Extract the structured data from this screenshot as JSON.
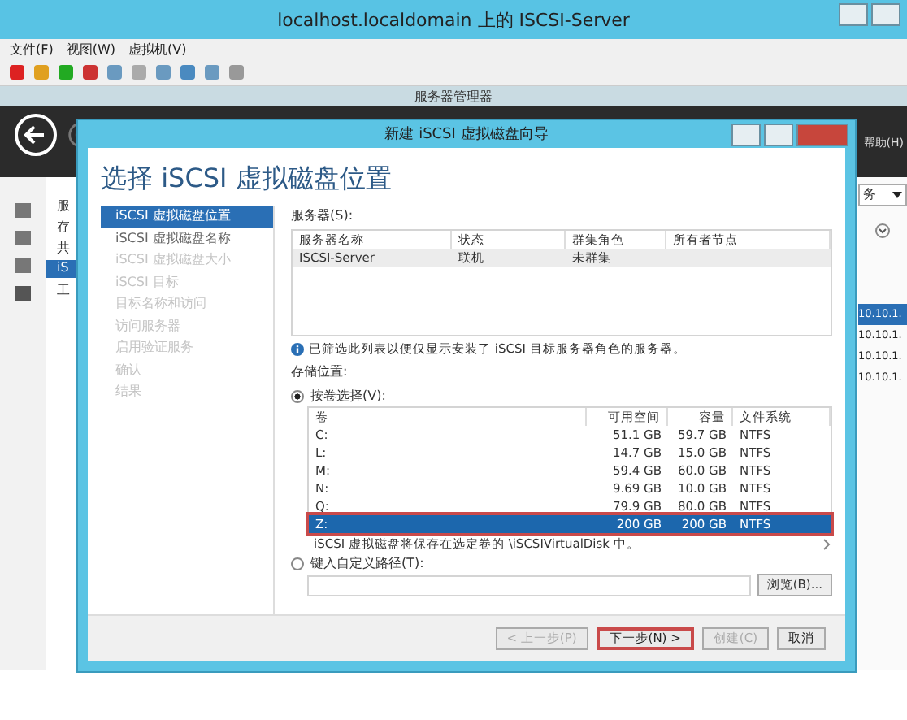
{
  "vm_window": {
    "title": "localhost.localdomain 上的 ISCSI-Server",
    "menu": [
      "文件(F)",
      "视图(W)",
      "虚拟机(V)"
    ]
  },
  "server_manager": {
    "title": "服务器管理器",
    "header_menu": [
      "帮助(H)"
    ],
    "left_pane": [
      {
        "label": "服",
        "selected": false
      },
      {
        "label": "存",
        "selected": false
      },
      {
        "label": "共",
        "selected": false
      },
      {
        "label": "iS",
        "selected": true
      },
      {
        "label": "工",
        "selected": false
      }
    ],
    "dropdown": "务",
    "right_list": [
      {
        "label": "10.10.1.",
        "selected": true
      },
      {
        "label": "10.10.1.",
        "selected": false
      },
      {
        "label": "10.10.1.",
        "selected": false
      },
      {
        "label": "10.10.1.",
        "selected": false
      }
    ]
  },
  "wizard": {
    "title": "新建 iSCSI 虚拟磁盘向导",
    "heading": "选择 iSCSI 虚拟磁盘位置",
    "steps": [
      {
        "label": "iSCSI 虚拟磁盘位置",
        "selected": true,
        "disabled": false
      },
      {
        "label": "iSCSI 虚拟磁盘名称",
        "selected": false,
        "disabled": false
      },
      {
        "label": "iSCSI 虚拟磁盘大小",
        "selected": false,
        "disabled": true
      },
      {
        "label": "iSCSI 目标",
        "selected": false,
        "disabled": true
      },
      {
        "label": "目标名称和访问",
        "selected": false,
        "disabled": true
      },
      {
        "label": "访问服务器",
        "selected": false,
        "disabled": true
      },
      {
        "label": "启用验证服务",
        "selected": false,
        "disabled": true
      },
      {
        "label": "确认",
        "selected": false,
        "disabled": true
      },
      {
        "label": "结果",
        "selected": false,
        "disabled": true
      }
    ],
    "servers_label": "服务器(S):",
    "servers": {
      "columns": [
        "服务器名称",
        "状态",
        "群集角色",
        "所有者节点"
      ],
      "rows": [
        {
          "cells": [
            "ISCSI-Server",
            "联机",
            "未群集",
            ""
          ],
          "selected": true
        }
      ]
    },
    "info": "已筛选此列表以便仅显示安装了 iSCSI 目标服务器角色的服务器。",
    "storage_label": "存储位置:",
    "by_volume": {
      "label": "按卷选择(V):",
      "selected": true
    },
    "volumes": {
      "columns": [
        "卷",
        "可用空间",
        "容量",
        "文件系统"
      ],
      "rows": [
        {
          "cells": [
            "C:",
            "51.1 GB",
            "59.7 GB",
            "NTFS"
          ],
          "selected": false
        },
        {
          "cells": [
            "L:",
            "14.7 GB",
            "15.0 GB",
            "NTFS"
          ],
          "selected": false
        },
        {
          "cells": [
            "M:",
            "59.4 GB",
            "60.0 GB",
            "NTFS"
          ],
          "selected": false
        },
        {
          "cells": [
            "N:",
            "9.69 GB",
            "10.0 GB",
            "NTFS"
          ],
          "selected": false
        },
        {
          "cells": [
            "Q:",
            "79.9 GB",
            "80.0 GB",
            "NTFS"
          ],
          "selected": false
        },
        {
          "cells": [
            "Z:",
            "200 GB",
            "200 GB",
            "NTFS"
          ],
          "selected": true
        }
      ]
    },
    "volume_note": "iSCSI 虚拟磁盘将保存在选定卷的 \\iSCSIVirtualDisk 中。",
    "custom_path": {
      "label": "键入自定义路径(T):",
      "selected": false
    },
    "browse": "浏览(B)...",
    "buttons": [
      {
        "label": "< 上一步(P)",
        "disabled": true,
        "highlighted": false
      },
      {
        "label": "下一步(N) >",
        "disabled": false,
        "highlighted": true
      },
      {
        "label": "创建(C)",
        "disabled": true,
        "highlighted": false
      },
      {
        "label": "取消",
        "disabled": false,
        "highlighted": false
      }
    ]
  }
}
